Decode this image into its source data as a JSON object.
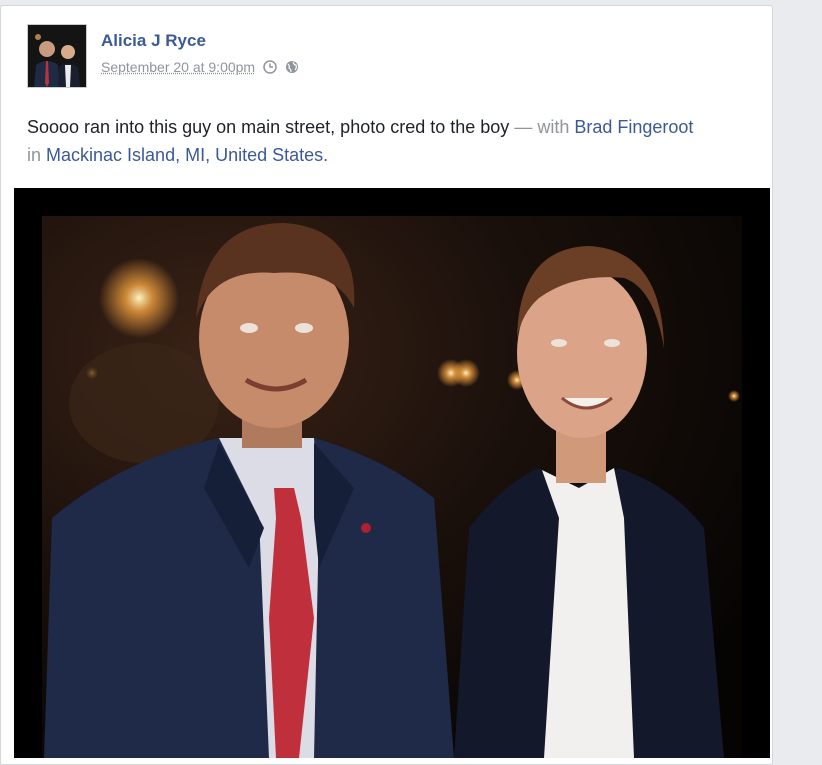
{
  "post": {
    "author": "Alicia J Ryce",
    "timestamp": "September 20 at 9:00pm",
    "icons": [
      "clock-icon",
      "globe-icon"
    ],
    "text": "Soooo ran into this guy on main street, photo cred to the boy",
    "with_separator": " — with ",
    "tagged_friend": "Brad Fingeroot",
    "location_prefix": "in ",
    "location": "Mackinac Island, MI, United States",
    "location_suffix": "."
  },
  "colors": {
    "link": "#3b5998",
    "muted": "#90949c",
    "text": "#1d2129"
  }
}
